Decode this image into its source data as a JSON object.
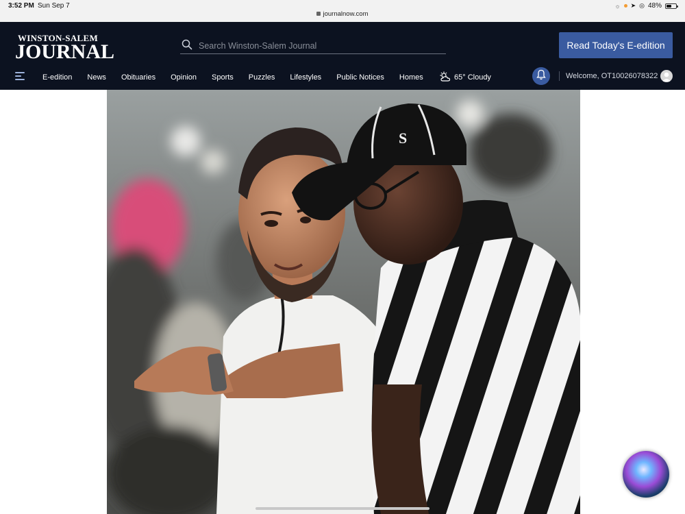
{
  "status_bar": {
    "time": "3:52 PM",
    "date": "Sun Sep 7",
    "url": "journalnow.com",
    "battery": "48%",
    "battery_level": 0.48
  },
  "header": {
    "logo_line1": "WINSTON-SALEM",
    "logo_line2": "JOURNAL",
    "search_placeholder": "Search Winston-Salem Journal",
    "eedition_button": "Read Today's E-edition",
    "nav": [
      "E-edition",
      "News",
      "Obituaries",
      "Opinion",
      "Sports",
      "Puzzles",
      "Lifestyles",
      "Public Notices",
      "Homes"
    ],
    "weather": "65° Cloudy",
    "welcome": "Welcome, OT10026078322"
  },
  "colors": {
    "header_bg": "#0c1220",
    "accent": "#3a5ba0",
    "status_bg": "#f2f2f2"
  },
  "icons": {
    "menu": "hamburger-icon",
    "search": "search-icon",
    "weather": "cloudy-sun-icon",
    "bell": "bell-icon",
    "user": "user-avatar-icon",
    "siri": "siri-icon"
  }
}
